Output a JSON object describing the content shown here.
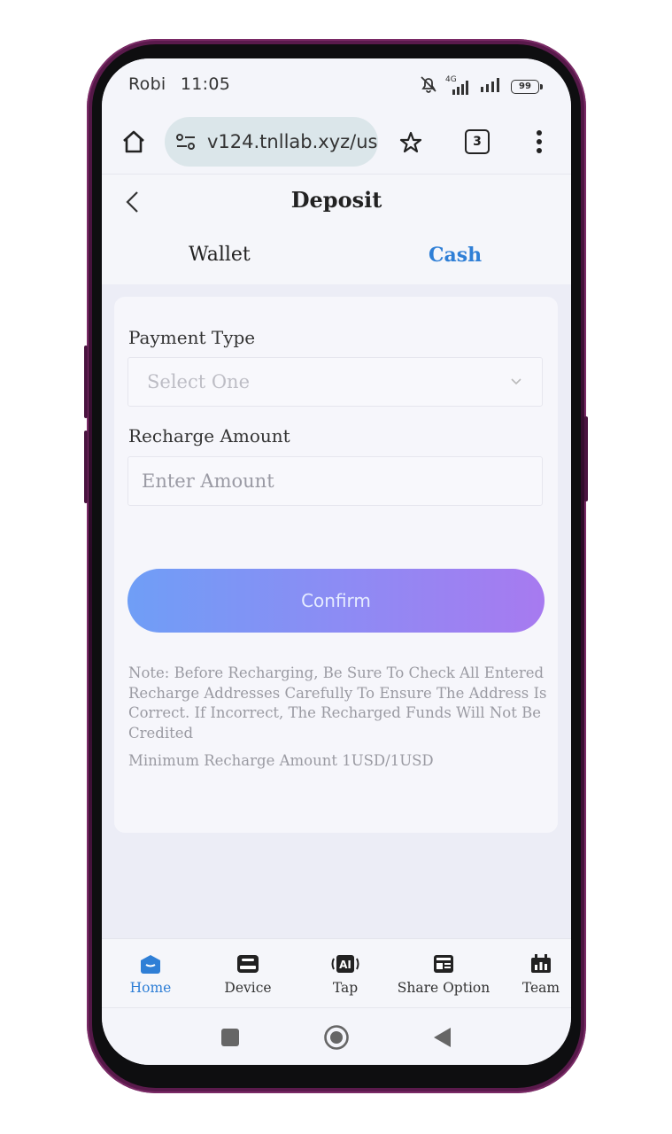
{
  "status_bar": {
    "carrier": "Robi",
    "time": "11:05",
    "network": "4G",
    "battery": "99"
  },
  "browser": {
    "url": "v124.tnllab.xyz/us",
    "tab_count": "3"
  },
  "header": {
    "title": "Deposit",
    "tabs": [
      {
        "label": "Wallet",
        "active": false
      },
      {
        "label": "Cash",
        "active": true
      }
    ]
  },
  "form": {
    "payment_type_label": "Payment Type",
    "payment_type_placeholder": "Select One",
    "recharge_amount_label": "Recharge Amount",
    "recharge_amount_placeholder": "Enter Amount",
    "confirm_label": "Confirm",
    "note": "Note: Before Recharging, Be Sure To Check All Entered Recharge Addresses Carefully To Ensure The Address Is Correct. If Incorrect, The Recharged Funds Will Not Be Credited",
    "minimum": "Minimum Recharge Amount 1USD/1USD"
  },
  "bottom_nav": [
    {
      "label": "Home",
      "icon": "home-icon",
      "active": true
    },
    {
      "label": "Device",
      "icon": "device-icon",
      "active": false
    },
    {
      "label": "Tap",
      "icon": "ai-tap-icon",
      "active": false
    },
    {
      "label": "Share Option",
      "icon": "share-option-icon",
      "active": false
    },
    {
      "label": "Team",
      "icon": "team-icon",
      "active": false
    }
  ],
  "colors": {
    "accent": "#2f7fd6",
    "button_gradient_start": "#6f9ef6",
    "button_gradient_end": "#a77af0",
    "phone_frame": "#5a1a4c"
  }
}
